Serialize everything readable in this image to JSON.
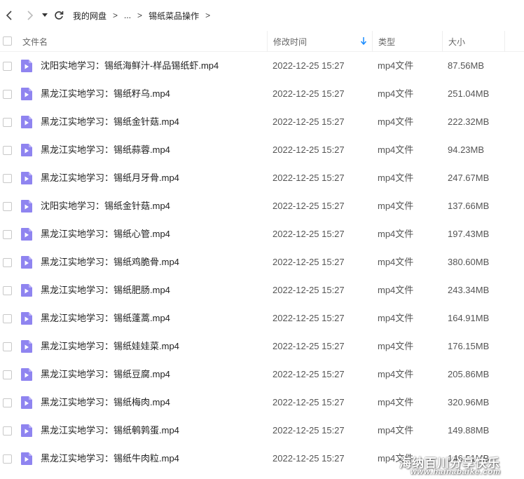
{
  "breadcrumb": {
    "items": [
      "我的网盘",
      "...",
      "锡纸菜品操作"
    ],
    "separator": ">"
  },
  "columns": {
    "name": "文件名",
    "modified": "修改时间",
    "type": "类型",
    "size": "大小"
  },
  "colors": {
    "accent": "#1a8cff",
    "file_icon": "#8f84f0"
  },
  "files": [
    {
      "name": "沈阳实地学习：锡纸海鲜汁-样品锡纸虾.mp4",
      "modified": "2022-12-25 15:27",
      "type": "mp4文件",
      "size": "87.56MB"
    },
    {
      "name": "黑龙江实地学习：锡纸籽乌.mp4",
      "modified": "2022-12-25 15:27",
      "type": "mp4文件",
      "size": "251.04MB"
    },
    {
      "name": "黑龙江实地学习：锡纸金针菇.mp4",
      "modified": "2022-12-25 15:27",
      "type": "mp4文件",
      "size": "222.32MB"
    },
    {
      "name": "黑龙江实地学习：锡纸蒜蓉.mp4",
      "modified": "2022-12-25 15:27",
      "type": "mp4文件",
      "size": "94.23MB"
    },
    {
      "name": "黑龙江实地学习：锡纸月牙骨.mp4",
      "modified": "2022-12-25 15:27",
      "type": "mp4文件",
      "size": "247.67MB"
    },
    {
      "name": "沈阳实地学习：锡纸金针菇.mp4",
      "modified": "2022-12-25 15:27",
      "type": "mp4文件",
      "size": "137.66MB"
    },
    {
      "name": "黑龙江实地学习：锡纸心管.mp4",
      "modified": "2022-12-25 15:27",
      "type": "mp4文件",
      "size": "197.43MB"
    },
    {
      "name": "黑龙江实地学习：锡纸鸡脆骨.mp4",
      "modified": "2022-12-25 15:27",
      "type": "mp4文件",
      "size": "380.60MB"
    },
    {
      "name": "黑龙江实地学习：锡纸肥肠.mp4",
      "modified": "2022-12-25 15:27",
      "type": "mp4文件",
      "size": "243.34MB"
    },
    {
      "name": "黑龙江实地学习：锡纸蓬蒿.mp4",
      "modified": "2022-12-25 15:27",
      "type": "mp4文件",
      "size": "164.91MB"
    },
    {
      "name": "黑龙江实地学习：锡纸娃娃菜.mp4",
      "modified": "2022-12-25 15:27",
      "type": "mp4文件",
      "size": "176.15MB"
    },
    {
      "name": "黑龙江实地学习：锡纸豆腐.mp4",
      "modified": "2022-12-25 15:27",
      "type": "mp4文件",
      "size": "205.86MB"
    },
    {
      "name": "黑龙江实地学习：锡纸梅肉.mp4",
      "modified": "2022-12-25 15:27",
      "type": "mp4文件",
      "size": "320.96MB"
    },
    {
      "name": "黑龙江实地学习：锡纸鹌鹑蛋.mp4",
      "modified": "2022-12-25 15:27",
      "type": "mp4文件",
      "size": "149.88MB"
    },
    {
      "name": "黑龙江实地学习：锡纸牛肉粒.mp4",
      "modified": "2022-12-25 15:27",
      "type": "mp4文件",
      "size": "146.51MB"
    }
  ],
  "watermark": {
    "line1": "海纳百川分享快乐",
    "line2": "www.hainabaike.com"
  }
}
